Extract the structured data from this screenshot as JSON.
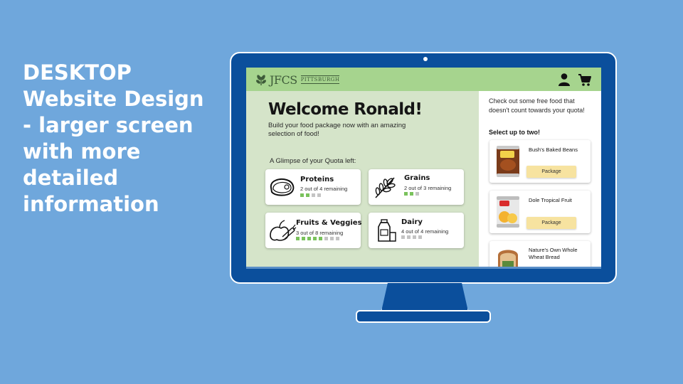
{
  "slide": {
    "heading": "DESKTOP Website Design - larger screen with more detailed information"
  },
  "header": {
    "logo_main": "JFCS",
    "logo_sub": "PITTSBURGH",
    "icons": [
      "user-icon",
      "cart-icon"
    ]
  },
  "welcome": {
    "title": "Welcome Ronald!",
    "subtitle": "Build your food package now with an amazing selection of food!"
  },
  "quota": {
    "label": "A Glimpse of your Quota left:",
    "items": [
      {
        "name": "Proteins",
        "remaining_text": "2 out of 4 remaining",
        "remaining": 2,
        "total": 4,
        "icon": "steak-icon"
      },
      {
        "name": "Grains",
        "remaining_text": "2 out of 3 remaining",
        "remaining": 2,
        "total": 3,
        "icon": "wheat-icon"
      },
      {
        "name": "Fruits & Veggies",
        "remaining_text": "3 out of 8 remaining",
        "remaining": 5,
        "total": 8,
        "icon": "produce-icon"
      },
      {
        "name": "Dairy",
        "remaining_text": "4 out of 4 remaining",
        "remaining": 0,
        "total": 4,
        "icon": "milk-icon"
      }
    ]
  },
  "free_food": {
    "intro": "Check out some free food that doesn't count towards your quota!",
    "select_label": "Select up to two!",
    "items": [
      {
        "name": "Bush's Baked Beans",
        "button": "Package",
        "icon": "bean-can-icon"
      },
      {
        "name": "Dole Tropical Fruit",
        "button": "Package",
        "icon": "fruit-can-icon"
      },
      {
        "name": "Nature's Own Whole Wheat Bread",
        "button": "Package",
        "icon": "bread-icon"
      }
    ]
  },
  "colors": {
    "background": "#6fa7dc",
    "monitor": "#0b4f9c",
    "topbar": "#a6d48e",
    "panel": "#d5e4c9",
    "bar_on": "#7ac25c",
    "bar_off": "#c4c4c4",
    "button": "#f7e3a0"
  }
}
